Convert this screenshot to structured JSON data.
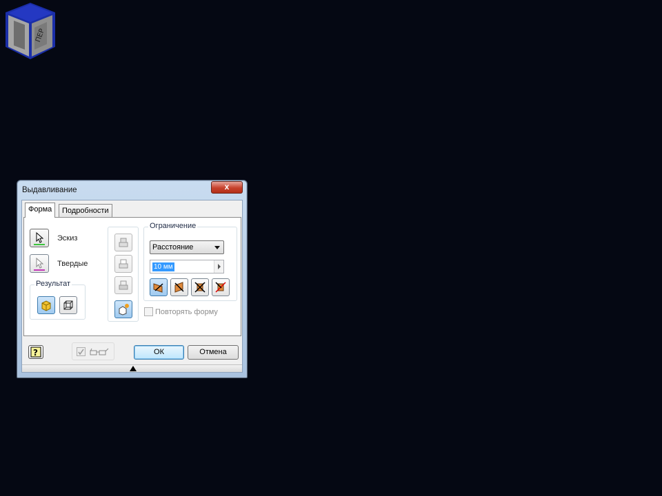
{
  "dialog": {
    "title": "Выдавливание",
    "close_label": "x"
  },
  "tabs": [
    {
      "label": "Форма",
      "active": true
    },
    {
      "label": "Подробности",
      "active": false
    }
  ],
  "profile": {
    "sketch_label": "Эскиз",
    "solids_label": "Твердые"
  },
  "result": {
    "group_label": "Результат"
  },
  "extents": {
    "group_label": "Ограничение",
    "type_value": "Расстояние",
    "distance_value": "10 мм"
  },
  "repeat_shape": {
    "label": "Повторять форму",
    "checked": false
  },
  "footer": {
    "ok_label": "ОК",
    "cancel_label": "Отмена"
  },
  "colors": {
    "background": "#050813",
    "accent": "#3399ff"
  }
}
